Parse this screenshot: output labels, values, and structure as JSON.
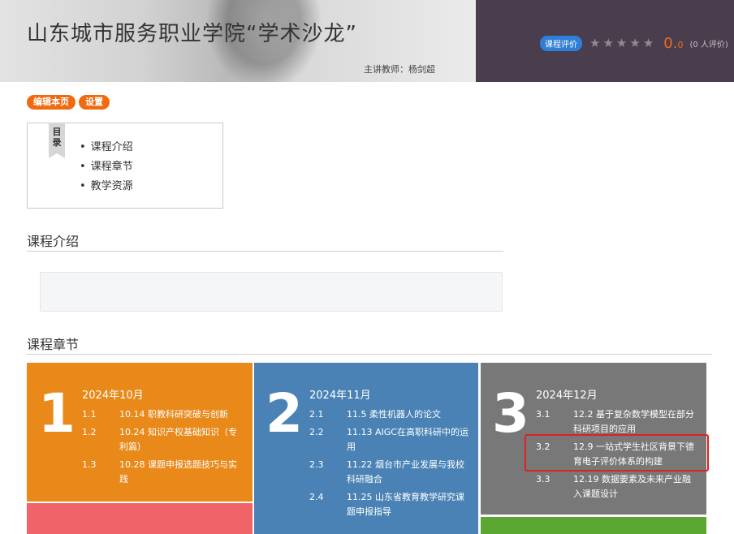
{
  "banner": {
    "title": "山东城市服务职业学院“学术沙龙”",
    "teacher": "主讲教师：杨剑超"
  },
  "rating": {
    "badge": "课程评价",
    "stars": [
      0,
      0,
      0,
      0,
      0
    ],
    "score_main": "0.",
    "score_decimal": "0",
    "count": "(0 人评价)"
  },
  "buttons": {
    "edit": "编辑本页",
    "settings": "设置"
  },
  "toc": {
    "ribbon": "目录",
    "items": [
      "课程介绍",
      "课程章节",
      "教学资源"
    ]
  },
  "sections": {
    "intro_title": "课程介绍",
    "chapters_title": "课程章节"
  },
  "colors": {
    "tile1": "#e8891a",
    "tile2": "#4a82b6",
    "tile3": "#787878",
    "tile4": "#f06368",
    "tile5": "#5aa832"
  },
  "chapters": [
    {
      "num": "1",
      "month": "2024年10月",
      "items": [
        {
          "no": "1.1",
          "title": "10.14 职教科研突破与创新"
        },
        {
          "no": "1.2",
          "title": "10.24 知识产权基础知识（专利篇）"
        },
        {
          "no": "1.3",
          "title": "10.28 课题申报选题技巧与实践"
        }
      ]
    },
    {
      "num": "2",
      "month": "2024年11月",
      "items": [
        {
          "no": "2.1",
          "title": "11.5 柔性机器人的论文"
        },
        {
          "no": "2.2",
          "title": "11.13 AIGC在高职科研中的运用"
        },
        {
          "no": "2.3",
          "title": "11.22 烟台市产业发展与我校科研融合"
        },
        {
          "no": "2.4",
          "title": "11.25 山东省教育教学研究课题申报指导"
        }
      ]
    },
    {
      "num": "3",
      "month": "2024年12月",
      "items": [
        {
          "no": "3.1",
          "title": "12.2 基于复杂数学模型在部分科研项目的应用"
        },
        {
          "no": "3.2",
          "title": "12.9 一站式学生社区背景下德育电子评价体系的构建"
        },
        {
          "no": "3.3",
          "title": "12.19 数据要素及未来产业融入课题设计"
        }
      ]
    }
  ]
}
